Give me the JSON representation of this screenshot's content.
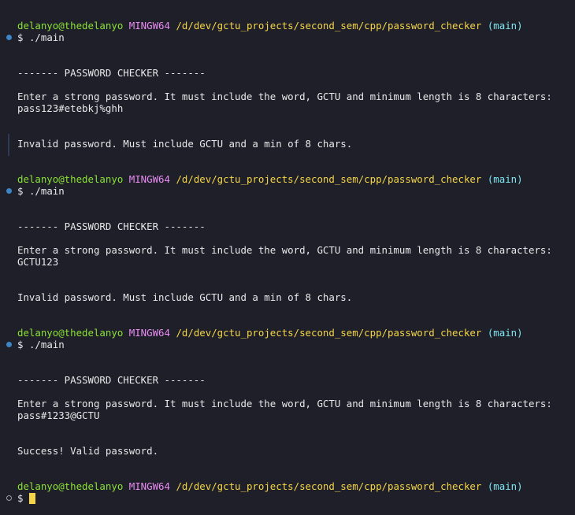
{
  "prompt": {
    "user_host": "delanyo@thedelanyo",
    "system": "MINGW64",
    "path": "/d/dev/gctu_projects/second_sem/cpp/password_checker",
    "branch": "(main)",
    "symbol": "$"
  },
  "command": "./main",
  "banner": "------- PASSWORD CHECKER -------",
  "instruction": "Enter a strong password. It must include the word, GCTU and minimum length is 8 characters:",
  "runs": [
    {
      "input": "pass123#etebkj%ghh",
      "result": "Invalid password. Must include GCTU and a min of 8 chars."
    },
    {
      "input": "GCTU123",
      "result": "Invalid password. Must include GCTU and a min of 8 chars."
    },
    {
      "input": "pass#1233@GCTU",
      "result": "Success! Valid password."
    }
  ],
  "colors": {
    "background": "#1e1f29",
    "user": "#8ae234",
    "system": "#e98bf2",
    "path": "#f5d547",
    "branch": "#7ee7f1",
    "text": "#e9e9ea",
    "marker": "#3b86c9"
  }
}
